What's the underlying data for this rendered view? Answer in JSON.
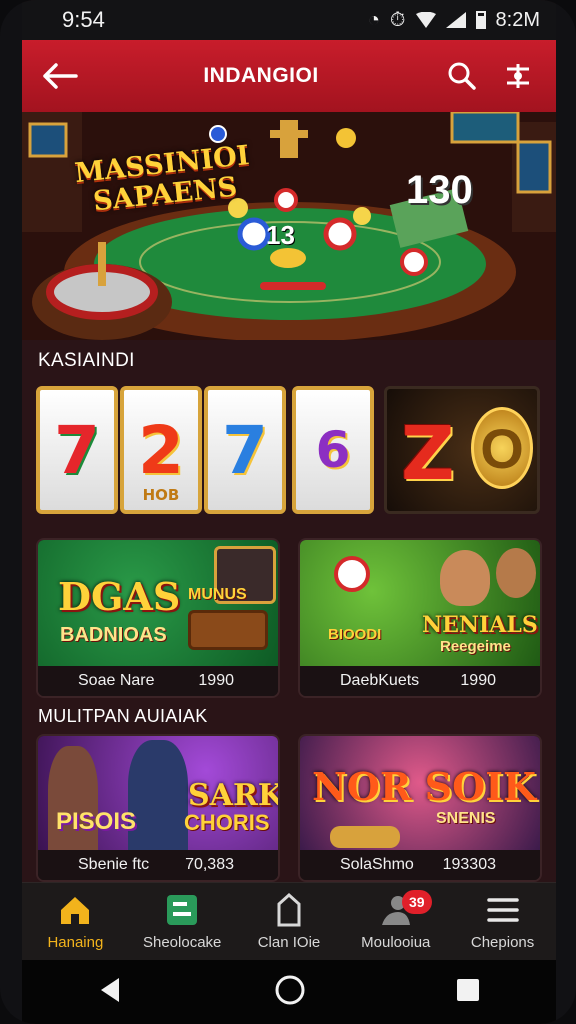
{
  "status_bar": {
    "time": "9:54",
    "right_text": "8:2M"
  },
  "app_bar": {
    "title": "INDANGIOI"
  },
  "hero": {
    "title_line1": "MASSINIOI",
    "title_line2": "SAPAENS",
    "number": "130",
    "center_number": "13"
  },
  "sections": {
    "casino_title": "KASIAINDI",
    "multi_title": "MULITPAN AUIAIAK"
  },
  "slots": {
    "reels": [
      {
        "symbol": "7",
        "color": "#e5262b"
      },
      {
        "symbol": "2",
        "color": "#ef3a18"
      },
      {
        "symbol": "7",
        "color": "#2a7fe0"
      },
      {
        "symbol": "6",
        "color": "#8c2fc2"
      }
    ],
    "reel_caption": "HOB",
    "tile_letters": {
      "z": "Z",
      "o": "O"
    }
  },
  "cards": [
    {
      "art_title": "DGAS",
      "art_sub": "BADNIOAS",
      "art_extra": "MUNUS",
      "label": "Soae Nare",
      "value": "1990"
    },
    {
      "art_title": "NENIALS",
      "art_sub": "Reegeime",
      "art_extra": "BIOODI",
      "label": "DaebKuets",
      "value": "1990"
    },
    {
      "art_title": "SARK",
      "art_sub": "CHORIS",
      "art_extra": "PISOIS",
      "label": "Sbenie ftc",
      "value": "70,383"
    },
    {
      "art_title": "NOR SOIK",
      "art_sub": "SNENIS",
      "art_extra": "",
      "label": "SolaShmo",
      "value": "193303"
    }
  ],
  "bottom_nav": [
    {
      "label": "Hanaing",
      "icon": "home-icon",
      "active": true
    },
    {
      "label": "Sheolocake",
      "icon": "ticket-icon",
      "active": false
    },
    {
      "label": "Clan IOie",
      "icon": "tag-icon",
      "active": false
    },
    {
      "label": "Moulooiua",
      "icon": "profile-icon",
      "active": false,
      "badge": "39"
    },
    {
      "label": "Chepions",
      "icon": "menu-icon",
      "active": false
    }
  ],
  "colors": {
    "accent": "#c81d2b",
    "active_nav": "#f2b31c",
    "background": "#2a1417"
  }
}
